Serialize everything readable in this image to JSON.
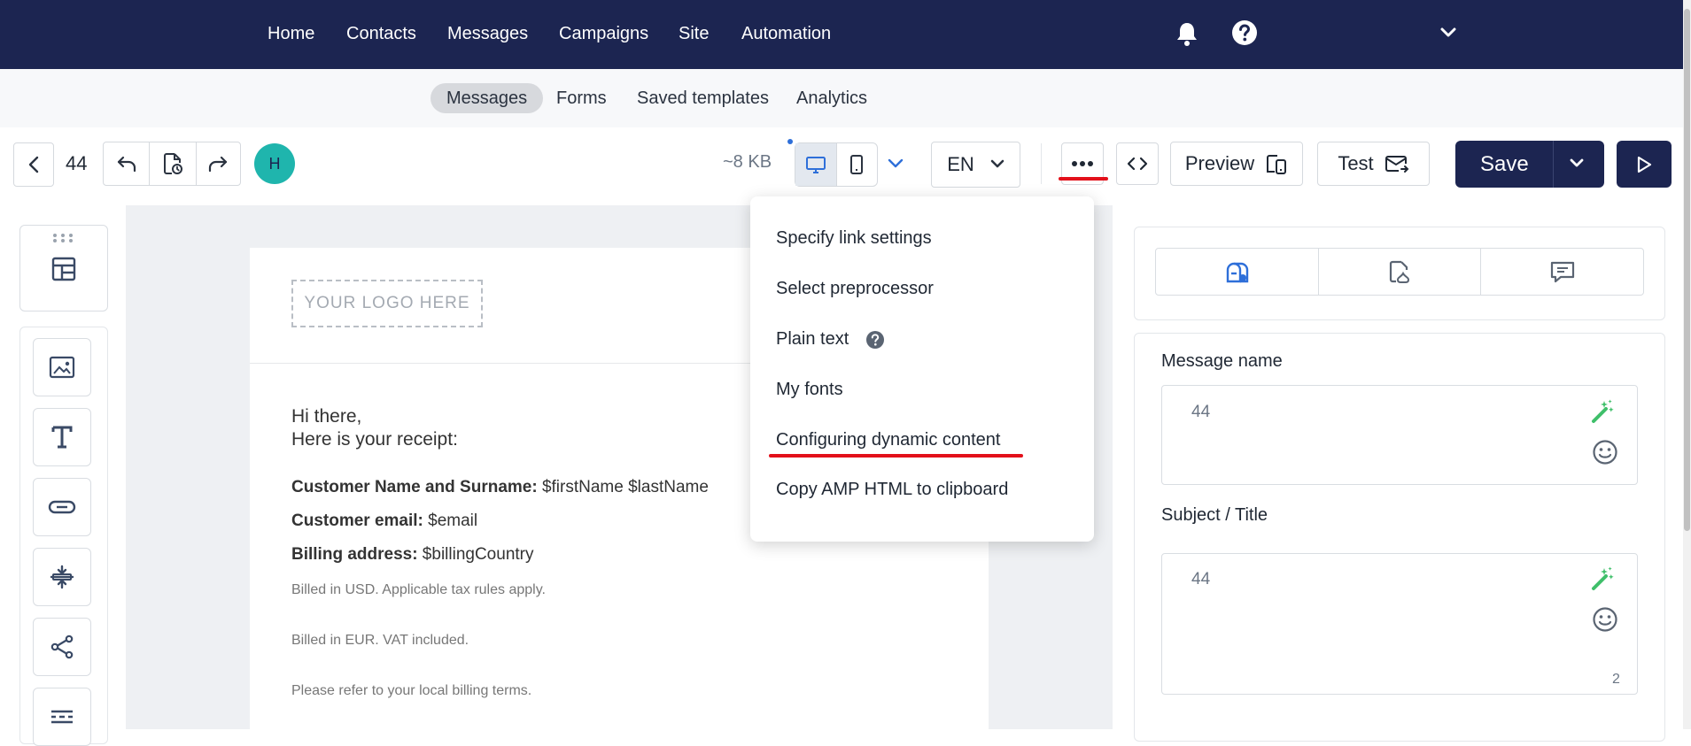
{
  "nav": {
    "items": [
      "Home",
      "Contacts",
      "Messages",
      "Campaigns",
      "Site",
      "Automation"
    ]
  },
  "subnav": {
    "items": [
      "Messages",
      "Forms",
      "Saved templates",
      "Analytics"
    ],
    "active": "Messages"
  },
  "toolbar": {
    "message_id": "44",
    "avatar_letter": "H",
    "size": "~8 KB",
    "language": "EN",
    "preview_label": "Preview",
    "test_label": "Test",
    "save_label": "Save"
  },
  "menu": {
    "items": [
      "Specify link settings",
      "Select preprocessor",
      "Plain text",
      "My fonts",
      "Configuring dynamic content",
      "Copy AMP HTML to clipboard"
    ]
  },
  "email": {
    "logo_placeholder": "YOUR LOGO HERE",
    "greeting": "Hi there,",
    "intro": "Here is your receipt:",
    "name_label": "Customer Name and Surname:",
    "name_value": " $firstName $lastName",
    "email_label": "Customer email:",
    "email_value": " $email",
    "billing_label": "Billing address:",
    "billing_value": " $billingCountry",
    "note_usd": "Billed in USD. Applicable tax rules apply.",
    "note_eur": "Billed in EUR. VAT included.",
    "note_local": "Please refer to your local billing terms."
  },
  "settings": {
    "message_name_label": "Message name",
    "message_name_value": "44",
    "subject_label": "Subject / Title",
    "subject_value": "44",
    "subject_counter": "2"
  },
  "colors": {
    "nav_bg": "#1c2551",
    "avatar": "#1fb5ad",
    "accent_blue": "#2e6fd9",
    "annotation_red": "#e3101a",
    "warning": "#c76a0e",
    "magic_green": "#3fbf6a"
  }
}
